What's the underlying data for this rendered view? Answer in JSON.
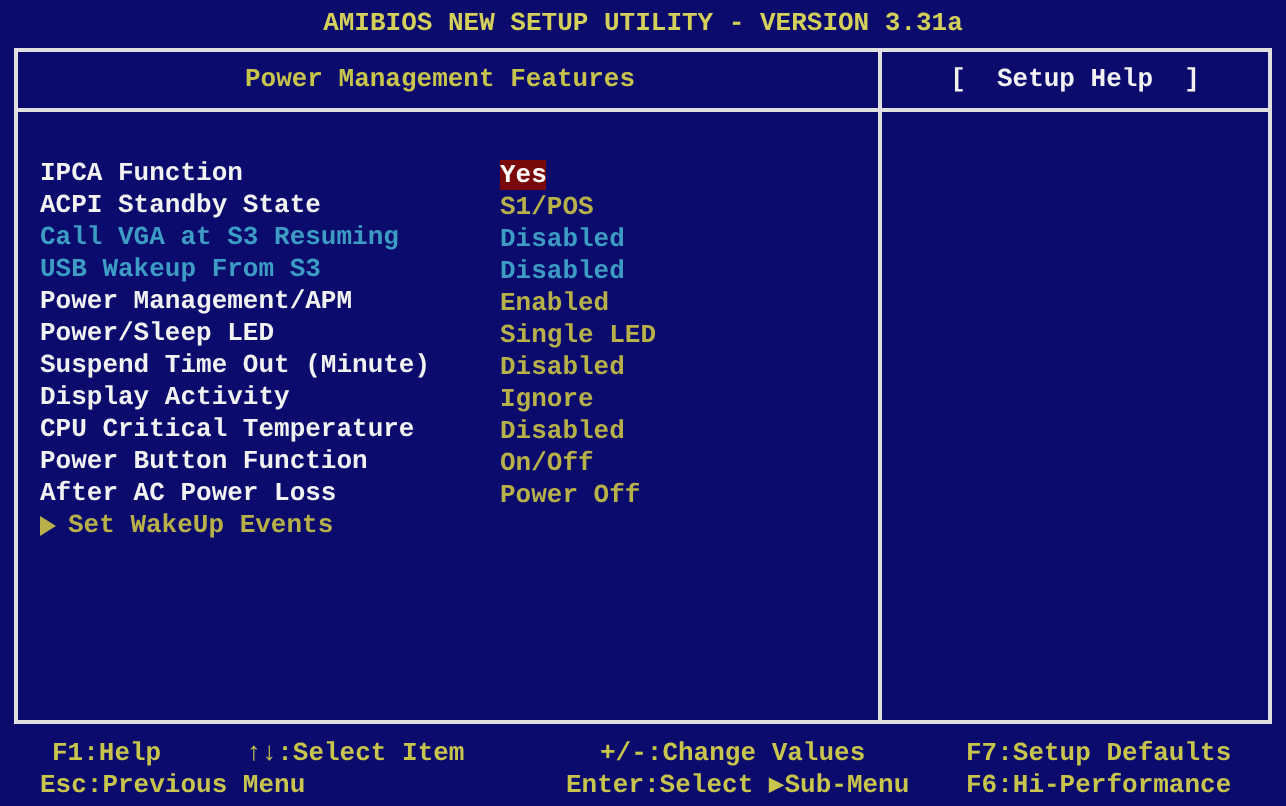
{
  "title": "AMIBIOS NEW SETUP UTILITY - VERSION 3.31a",
  "panel": {
    "title": "Power Management Features",
    "help_title": "[  Setup Help  ]"
  },
  "items": [
    {
      "kind": "setting",
      "label": "IPCA Function",
      "value": "Yes",
      "disabled": false,
      "selected": true
    },
    {
      "kind": "setting",
      "label": "ACPI Standby State",
      "value": "S1/POS",
      "disabled": false,
      "selected": false
    },
    {
      "kind": "setting",
      "label": "Call VGA at S3 Resuming",
      "value": "Disabled",
      "disabled": true,
      "selected": false
    },
    {
      "kind": "setting",
      "label": "USB Wakeup From S3",
      "value": "Disabled",
      "disabled": true,
      "selected": false
    },
    {
      "kind": "setting",
      "label": "Power Management/APM",
      "value": "Enabled",
      "disabled": false,
      "selected": false
    },
    {
      "kind": "setting",
      "label": "Power/Sleep LED",
      "value": "Single LED",
      "disabled": false,
      "selected": false
    },
    {
      "kind": "setting",
      "label": "Suspend Time Out (Minute)",
      "value": "Disabled",
      "disabled": false,
      "selected": false
    },
    {
      "kind": "setting",
      "label": "Display Activity",
      "value": "Ignore",
      "disabled": false,
      "selected": false
    },
    {
      "kind": "setting",
      "label": "CPU Critical Temperature",
      "value": "Disabled",
      "disabled": false,
      "selected": false
    },
    {
      "kind": "setting",
      "label": "Power Button Function",
      "value": "On/Off",
      "disabled": false,
      "selected": false
    },
    {
      "kind": "setting",
      "label": "After AC Power Loss",
      "value": "Power Off",
      "disabled": false,
      "selected": false
    },
    {
      "kind": "submenu",
      "label": "Set WakeUp Events"
    }
  ],
  "footer": [
    [
      "F1:Help",
      "↑↓:Select Item",
      "+/-:Change Values",
      "F7:Setup Defaults"
    ],
    [
      "Esc:Previous Menu",
      "Enter:Select ▶Sub-Menu",
      "F6:Hi-Performance"
    ]
  ]
}
